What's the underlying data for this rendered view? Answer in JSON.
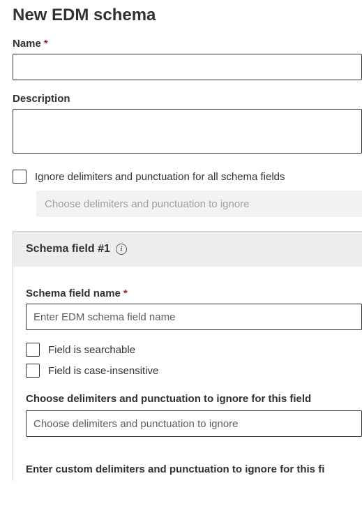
{
  "pageTitle": "New EDM schema",
  "name": {
    "label": "Name",
    "required": true,
    "value": ""
  },
  "description": {
    "label": "Description",
    "value": ""
  },
  "ignoreAll": {
    "label": "Ignore delimiters and punctuation for all schema fields",
    "checked": false,
    "dropdownPlaceholder": "Choose delimiters and punctuation to ignore"
  },
  "field1": {
    "header": "Schema field #1",
    "nameLabel": "Schema field name",
    "nameRequired": true,
    "namePlaceholder": "Enter EDM schema field name",
    "nameValue": "",
    "searchableLabel": "Field is searchable",
    "searchableChecked": false,
    "caseInsensitiveLabel": "Field is case-insensitive",
    "caseInsensitiveChecked": false,
    "ignoreLabel": "Choose delimiters and punctuation to ignore for this field",
    "ignorePlaceholder": "Choose delimiters and punctuation to ignore",
    "customLabel": "Enter custom delimiters and punctuation to ignore for this fi"
  }
}
